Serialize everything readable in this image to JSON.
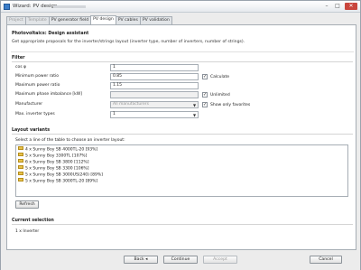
{
  "window": {
    "title": "Wizard: PV design",
    "controls": {
      "minimize": "–",
      "maximize": "□",
      "close": "✕"
    }
  },
  "tabs": [
    {
      "label": "Project",
      "state": "disabled"
    },
    {
      "label": "Template",
      "state": "disabled"
    },
    {
      "label": "PV generator field",
      "state": "normal"
    },
    {
      "label": "PV design",
      "state": "active"
    },
    {
      "label": "PV cables",
      "state": "normal"
    },
    {
      "label": "PV validation",
      "state": "normal"
    }
  ],
  "header": {
    "title": "Photovoltaics: Design assistant",
    "subtitle": "Get appropriate proposals for the inverter/strings layout (inverter type, number of inverters, number of strings)."
  },
  "filter": {
    "title": "Filter",
    "cos_phi": {
      "label": "cos φ",
      "value": "1"
    },
    "min_power_ratio": {
      "label": "Minimum power ratio",
      "value": "0.85"
    },
    "max_power_ratio": {
      "label": "Maximum power ratio",
      "value": "1.15"
    },
    "max_phase_imbalance": {
      "label": "Maximum phase imbalance [kW]",
      "value": ""
    },
    "manufacturer": {
      "label": "Manufacturer",
      "value": "All manufacturers"
    },
    "max_inverter_types": {
      "label": "Max. inverter types",
      "value": "1"
    },
    "calculate": {
      "label": "Calculate",
      "checked": true
    },
    "unlimited": {
      "label": "Unlimited",
      "checked": true
    },
    "show_only_favorites": {
      "label": "Show only favorites",
      "checked": true
    }
  },
  "layout_variants": {
    "title": "Layout variants",
    "hint": "Select a line of the table to choose an inverter layout:",
    "items": [
      "4 x Sunny Boy SB 4000TL-20 [93%]",
      "5 x Sunny Boy 3300TL [107%]",
      "6 x Sunny Boy SB 3800 [112%]",
      "5 x Sunny Boy SB 3300 [106%]",
      "5 x Sunny Boy SB 3000US(240) [89%]",
      "5 x Sunny Boy SB 3000TL-20 [89%]"
    ],
    "refresh_label": "Refresh"
  },
  "current_selection": {
    "title": "Current selection",
    "value": "1 x Inverter"
  },
  "footer": {
    "back": "Back",
    "continue": "Continue",
    "accept": "Accept",
    "cancel": "Cancel"
  },
  "colors": {
    "window_bg": "#ececec",
    "panel_bg": "#ffffff",
    "border": "#a6adb4",
    "folder_icon": "#e8c24a",
    "close_button": "#c9463d"
  }
}
